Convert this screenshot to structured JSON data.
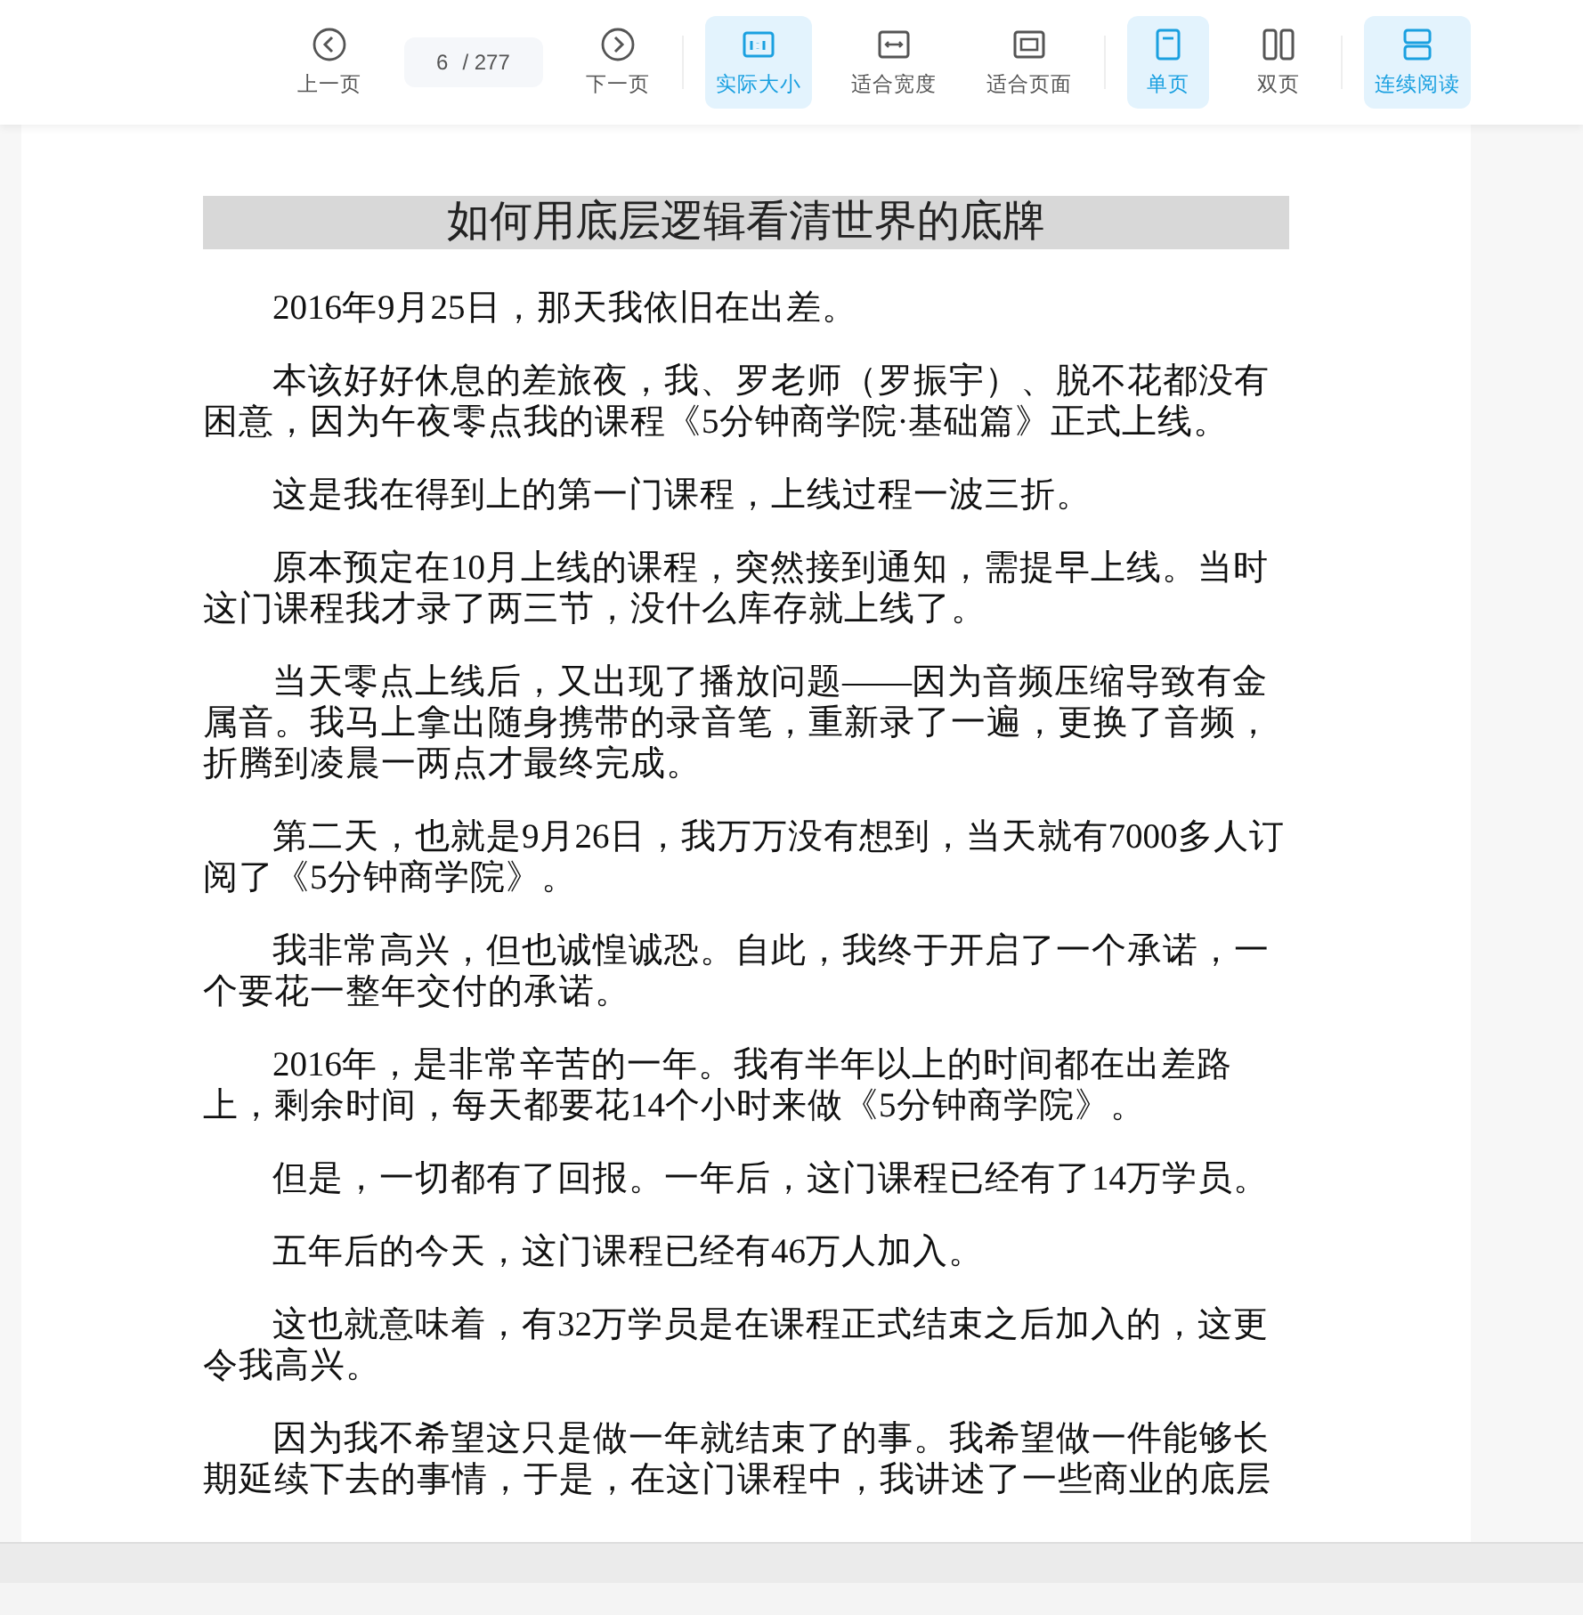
{
  "toolbar": {
    "prev": {
      "label": "上一页"
    },
    "page": {
      "current": "6",
      "total": "/ 277"
    },
    "next": {
      "label": "下一页"
    },
    "zoom_modes": [
      {
        "kind": "actual",
        "label": "实际大小",
        "selected": true
      },
      {
        "kind": "width",
        "label": "适合宽度",
        "selected": false
      },
      {
        "kind": "page",
        "label": "适合页面",
        "selected": false
      }
    ],
    "page_modes": [
      {
        "kind": "single",
        "label": "单页",
        "selected": true
      },
      {
        "kind": "double",
        "label": "双页",
        "selected": false
      }
    ],
    "continuous": {
      "label": "连续阅读",
      "selected": true
    }
  },
  "article": {
    "title": "如何用底层逻辑看清世界的底牌",
    "paragraphs": [
      "2016年9月25日，那天我依旧在出差。",
      "本该好好休息的差旅夜，我、罗老师（罗振宇）、脱不花都没有困意，因为午夜零点我的课程《5分钟商学院·基础篇》正式上线。",
      "这是我在得到上的第一门课程，上线过程一波三折。",
      "原本预定在10月上线的课程，突然接到通知，需提早上线。当时这门课程我才录了两三节，没什么库存就上线了。",
      "当天零点上线后，又出现了播放问题——因为音频压缩导致有金属音。我马上拿出随身携带的录音笔，重新录了一遍，更换了音频，折腾到凌晨一两点才最终完成。",
      "第二天，也就是9月26日，我万万没有想到，当天就有7000多人订阅了《5分钟商学院》。",
      "我非常高兴，但也诚惶诚恐。自此，我终于开启了一个承诺，一个要花一整年交付的承诺。",
      "2016年，是非常辛苦的一年。我有半年以上的时间都在出差路上，剩余时间，每天都要花14个小时来做《5分钟商学院》。",
      "但是，一切都有了回报。一年后，这门课程已经有了14万学员。",
      "五年后的今天，这门课程已经有46万人加入。",
      "这也就意味着，有32万学员是在课程正式结束之后加入的，这更令我高兴。",
      "因为我不希望这只是做一年就结束了的事。我希望做一件能够长期延续下去的事情，于是，在这门课程中，我讲述了一些商业的底层"
    ]
  }
}
